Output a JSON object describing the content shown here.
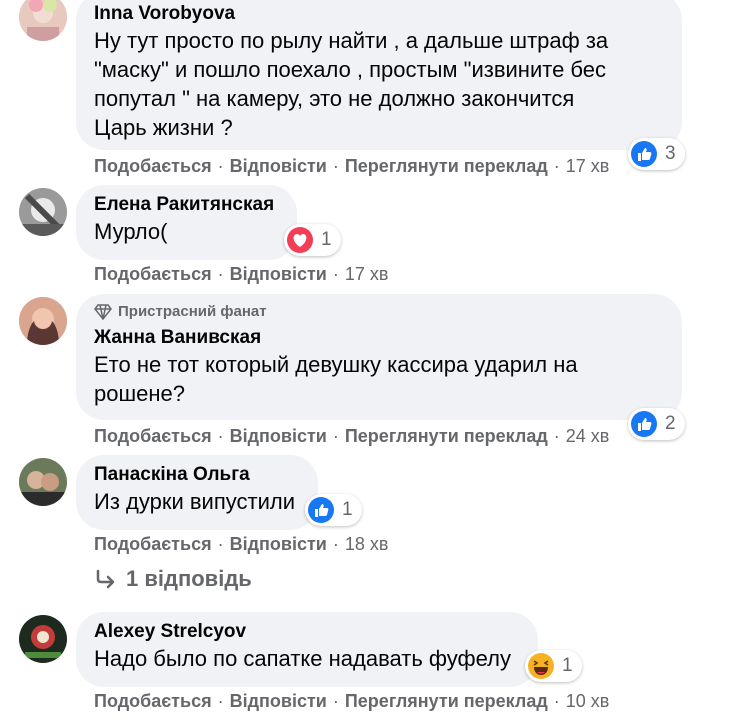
{
  "actions": {
    "like": "Подобається",
    "reply": "Відповісти",
    "translate": "Переглянути переклад",
    "sep": "·"
  },
  "comments": [
    {
      "author": "Inna Vorobyova",
      "text": "Ну тут просто по рылу найти , а дальше штраф за\n\"маску\" и пошло поехало , простым \"извините бес\nпопутал \" на камеру, это не должно закончится\nЦарь жизни ?",
      "time": "17 хв",
      "reaction_icon": "like-icon",
      "reaction_count": "3"
    },
    {
      "author": "Елена Ракитянская",
      "text": "Мурло(",
      "time": "17 хв",
      "reaction_icon": "love-icon",
      "reaction_count": "1"
    },
    {
      "badge": "Пристрасний фанат",
      "author": "Жанна Ванивская",
      "text": "Ето не тот который девушку кассира ударил на\nрошене?",
      "time": "24 хв",
      "reaction_icon": "like-icon",
      "reaction_count": "2"
    },
    {
      "author": "Панаскіна Ольга",
      "text": "Из дурки випустили",
      "time": "18 хв",
      "reaction_icon": "like-icon",
      "reaction_count": "1",
      "replies": "1 відповідь"
    },
    {
      "author": "Alexey Strelcyov",
      "text": "Надо было по сапатке надавать фуфелу",
      "time": "10 хв",
      "reaction_icon": "haha-icon",
      "reaction_count": "1"
    }
  ],
  "colors": {
    "bubble": "#f0f2f5",
    "meta": "#65676b",
    "like_blue": "#1877f2",
    "love_red": "#f33e58",
    "haha_yellow": "#f7b125"
  }
}
